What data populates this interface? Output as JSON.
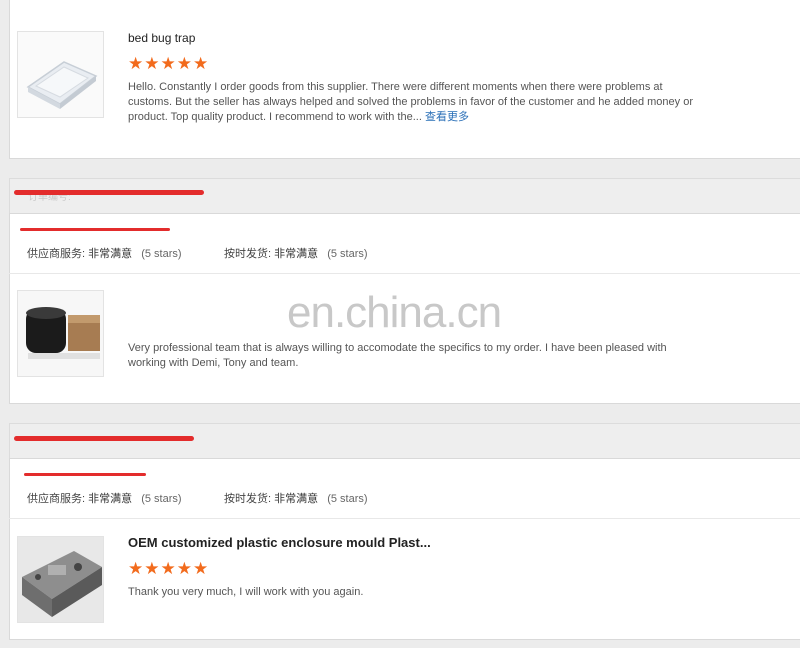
{
  "watermark": "en.china.cn",
  "reviews": [
    {
      "product_title": "bed bug trap",
      "stars": "★★★★★",
      "rating": 5,
      "text": "Hello. Constantly I order goods from this supplier. There were different moments when there were problems at customs. But the seller has always helped and solved the problems in favor of the customer and he added money or product. Top quality product. I recommend to work with the...",
      "more_link": "查看更多"
    },
    {
      "order_label": "订单编号:",
      "supplier_service_label": "供应商服务:",
      "supplier_service_value": "非常满意",
      "supplier_service_count": "(5 stars)",
      "ontime_label": "按时发货:",
      "ontime_value": "非常满意",
      "ontime_count": "(5 stars)",
      "text": "Very professional team that is always willing to accomodate the specifics to my order. I have been pleased with working with Demi, Tony and team."
    },
    {
      "supplier_service_label": "供应商服务:",
      "supplier_service_value": "非常满意",
      "supplier_service_count": "(5 stars)",
      "ontime_label": "按时发货:",
      "ontime_value": "非常满意",
      "ontime_count": "(5 stars)",
      "product_title": "OEM customized plastic enclosure mould Plast...",
      "stars": "★★★★★",
      "rating": 5,
      "text": "Thank you very much, I will work with you again."
    }
  ],
  "colors": {
    "star": "#f26b1d",
    "link": "#2a6fb7",
    "redaction": "#e32c2c"
  }
}
